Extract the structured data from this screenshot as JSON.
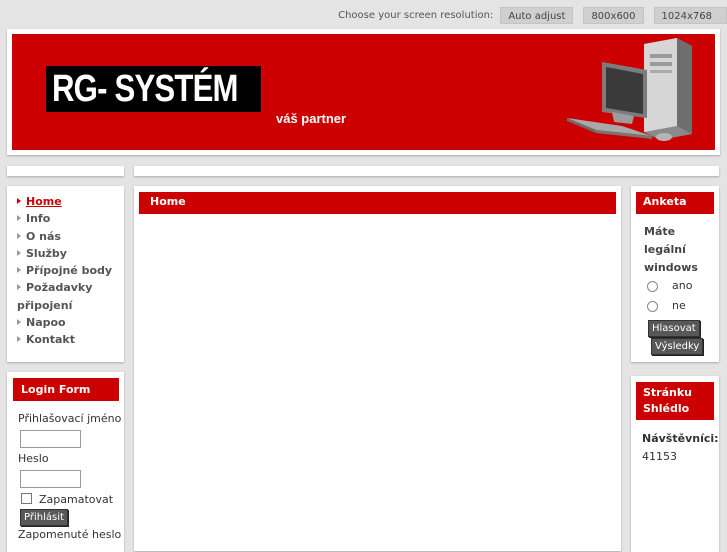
{
  "resolution_bar": {
    "label": "Choose your screen resolution:",
    "options": [
      "Auto adjust",
      "800x600",
      "1024x768"
    ]
  },
  "header": {
    "logo_text": "RG- SYSTÉM",
    "slogan": "váš partner"
  },
  "menu": {
    "items": [
      "Home",
      "Info",
      "O nás",
      "Služby",
      "Přípojné body",
      "Požadavky",
      "připojení",
      "Napoo",
      "Kontakt"
    ]
  },
  "login": {
    "title": "Login Form",
    "username_label": "Přihlašovací jméno",
    "password_label": "Heslo",
    "remember_label": "Zapamatovat",
    "submit_label": "Přihlásit",
    "forgot_label": "Zapomenuté heslo"
  },
  "content": {
    "title": "Home"
  },
  "poll": {
    "title": "Anketa",
    "question_lines": [
      "Máte",
      "legální",
      "windows"
    ],
    "options": [
      "ano",
      "ne"
    ],
    "vote_label": "Hlasovat",
    "results_label": "Výsledky"
  },
  "visits": {
    "title_lines": [
      "Stránku",
      "Shlédlo"
    ],
    "label": "Návštěvníci:",
    "count": "41153"
  },
  "colors": {
    "accent": "#cc0000",
    "background": "#e4e4e4"
  }
}
